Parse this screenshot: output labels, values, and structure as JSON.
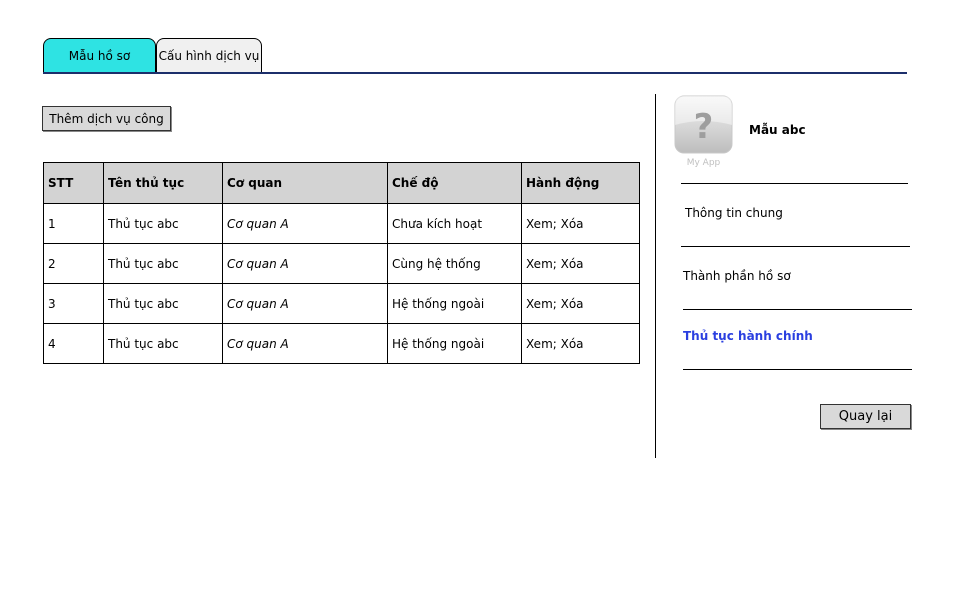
{
  "tabs": [
    {
      "label": "Mẫu hồ sơ",
      "active": true
    },
    {
      "label": "Cấu hình dịch vụ",
      "active": false
    }
  ],
  "colors": {
    "tab_active": "#2ee3e3",
    "tab_underline": "#1c2f6b",
    "active_link": "#2a3fe0",
    "table_header_bg": "#d3d3d3"
  },
  "toolbar": {
    "add_service_label": "Thêm dịch vụ công"
  },
  "table": {
    "headers": [
      "STT",
      "Tên thủ tục",
      "Cơ quan",
      "Chế độ",
      "Hành động"
    ],
    "rows": [
      [
        "1",
        "Thủ tục abc",
        "Cơ quan A",
        "Chưa kích hoạt",
        "Xem; Xóa"
      ],
      [
        "2",
        "Thủ tục abc",
        "Cơ quan A",
        "Cùng hệ thống",
        "Xem; Xóa"
      ],
      [
        "3",
        "Thủ tục abc",
        "Cơ quan A",
        "Hệ thống ngoài",
        "Xem; Xóa"
      ],
      [
        "4",
        "Thủ tục abc",
        "Cơ quan A",
        "Hệ thống ngoài",
        "Xem; Xóa"
      ]
    ]
  },
  "sidebar": {
    "app_icon": {
      "name": "question-app-icon",
      "caption": "My App"
    },
    "title": "Mẫu abc",
    "items": [
      {
        "label": "Thông tin chung",
        "active": false
      },
      {
        "label": "Thành phần hồ sơ",
        "active": false
      },
      {
        "label": "Thủ tục hành chính",
        "active": true
      }
    ],
    "back_label": "Quay lại"
  }
}
